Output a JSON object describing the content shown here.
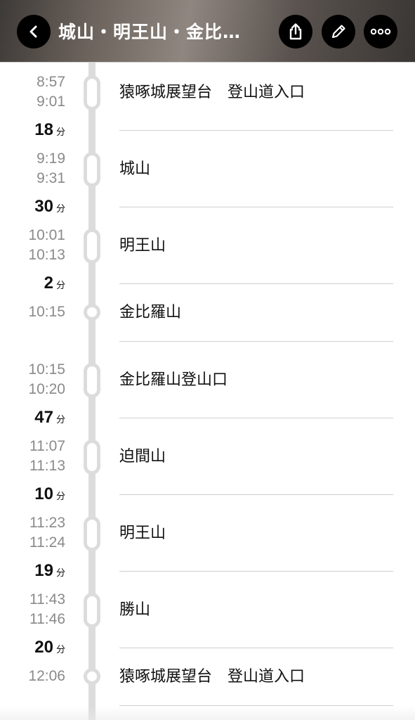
{
  "header": {
    "title": "城山・明王山・金比…",
    "back_icon": "chevron-left-icon",
    "share_icon": "share-icon",
    "edit_icon": "pencil-icon",
    "more_icon": "more-horizontal-icon"
  },
  "timeline": {
    "stops": [
      {
        "arrive": "8:57",
        "depart": "9:01",
        "name": "猿啄城展望台　登山道入口"
      },
      {
        "arrive": "9:19",
        "depart": "9:31",
        "name": "城山"
      },
      {
        "arrive": "10:01",
        "depart": "10:13",
        "name": "明王山"
      },
      {
        "time": "10:15",
        "name": "金比羅山"
      },
      {
        "arrive": "10:15",
        "depart": "10:20",
        "name": "金比羅山登山口"
      },
      {
        "arrive": "11:07",
        "depart": "11:13",
        "name": "迫間山"
      },
      {
        "arrive": "11:23",
        "depart": "11:24",
        "name": "明王山"
      },
      {
        "arrive": "11:43",
        "depart": "11:46",
        "name": "勝山"
      },
      {
        "time": "12:06",
        "name": "猿啄城展望台　登山道入口"
      }
    ],
    "durations": [
      {
        "value": "18",
        "unit": "分"
      },
      {
        "value": "30",
        "unit": "分"
      },
      {
        "value": "2",
        "unit": "分"
      },
      {
        "value": "47",
        "unit": "分"
      },
      {
        "value": "10",
        "unit": "分"
      },
      {
        "value": "19",
        "unit": "分"
      },
      {
        "value": "20",
        "unit": "分"
      }
    ]
  }
}
